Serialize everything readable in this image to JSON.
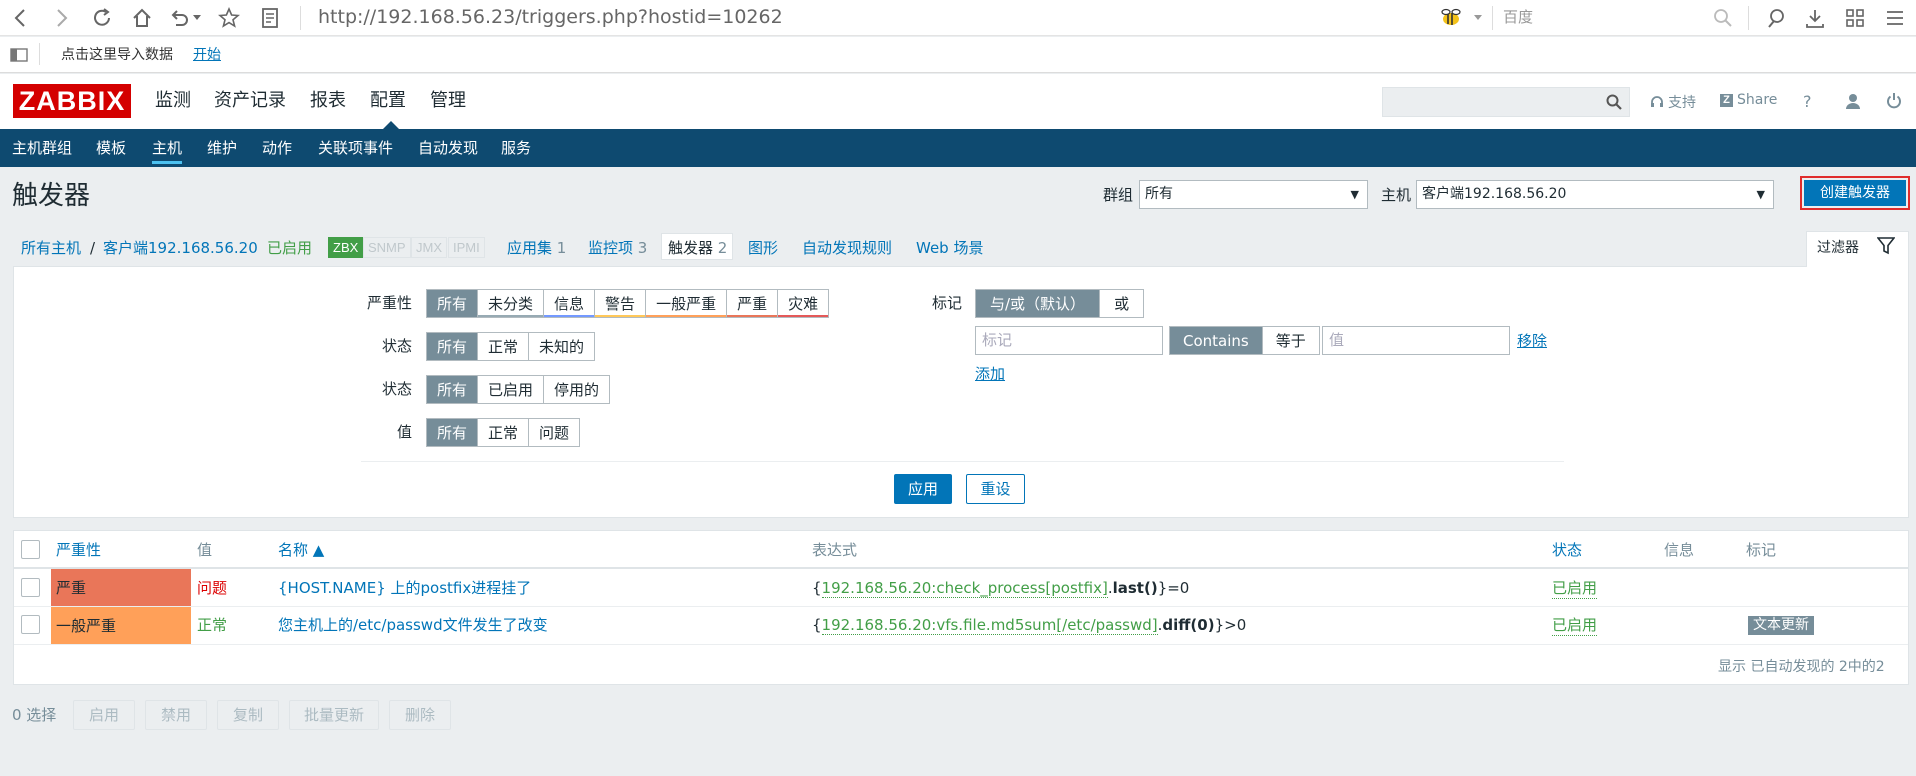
{
  "browser": {
    "url": "http://192.168.56.23/triggers.php?hostid=10262",
    "search_engine": "百度",
    "bookmark_text": "点击这里导入数据",
    "bookmark_link": "开始"
  },
  "header": {
    "logo": "ZABBIX",
    "menu": [
      "监测",
      "资产记录",
      "报表",
      "配置",
      "管理"
    ],
    "active_menu": "配置",
    "support": "支持",
    "share": "Share",
    "help": "?"
  },
  "subnav": {
    "items": [
      "主机群组",
      "模板",
      "主机",
      "维护",
      "动作",
      "关联项事件",
      "自动发现",
      "服务"
    ],
    "active": "主机"
  },
  "page": {
    "title": "触发器",
    "group_label": "群组",
    "group_value": "所有",
    "host_label": "主机",
    "host_value": "客户端192.168.56.20",
    "create_button": "创建触发器"
  },
  "breadcrumb": {
    "all_hosts": "所有主机",
    "separator": "/",
    "host": "客户端192.168.56.20",
    "status": "已启用",
    "tags": [
      "ZBX",
      "SNMP",
      "JMX",
      "IPMI"
    ],
    "app_label": "应用集",
    "app_count": "1",
    "items_label": "监控项",
    "items_count": "3",
    "triggers_label": "触发器",
    "triggers_count": "2",
    "graphs": "图形",
    "discovery": "自动发现规则",
    "web": "Web 场景"
  },
  "filter": {
    "tab_label": "过滤器",
    "severity_label": "严重性",
    "severity_options": [
      "所有",
      "未分类",
      "信息",
      "警告",
      "一般严重",
      "严重",
      "灾难"
    ],
    "state_label": "状态",
    "state_options": [
      "所有",
      "正常",
      "未知的"
    ],
    "status_label": "状态",
    "status_options": [
      "所有",
      "已启用",
      "停用的"
    ],
    "value_label": "值",
    "value_options": [
      "所有",
      "正常",
      "问题"
    ],
    "tags_label": "标记",
    "tags_mode": [
      "与/或（默认）",
      "或"
    ],
    "tag_placeholder": "标记",
    "tag_operators": [
      "Contains",
      "等于"
    ],
    "value_placeholder": "值",
    "remove": "移除",
    "add": "添加",
    "apply": "应用",
    "reset": "重设"
  },
  "table": {
    "headers": [
      "严重性",
      "值",
      "名称 ▲",
      "表达式",
      "状态",
      "信息",
      "标记"
    ],
    "rows": [
      {
        "severity": "严重",
        "severity_color": "#e97659",
        "value": "问题",
        "name": "{HOST.NAME} 上的postfix进程挂了",
        "expr_open": "{",
        "expr_item": "192.168.56.20:check_process[postfix]",
        "expr_dot": ".",
        "expr_func": "last()",
        "expr_tail": "}=0",
        "status": "已启用",
        "tag": ""
      },
      {
        "severity": "一般严重",
        "severity_color": "#ffa059",
        "value": "正常",
        "name": "您主机上的/etc/passwd文件发生了改变",
        "expr_open": "{",
        "expr_item": "192.168.56.20:vfs.file.md5sum[/etc/passwd]",
        "expr_dot": ".",
        "expr_func": "diff(0)",
        "expr_tail": "}>0",
        "status": "已启用",
        "tag": "文本更新"
      }
    ],
    "summary": "显示 已自动发现的 2中的2"
  },
  "footer": {
    "selected": "0 选择",
    "buttons": [
      "启用",
      "禁用",
      "复制",
      "批量更新",
      "删除"
    ]
  }
}
